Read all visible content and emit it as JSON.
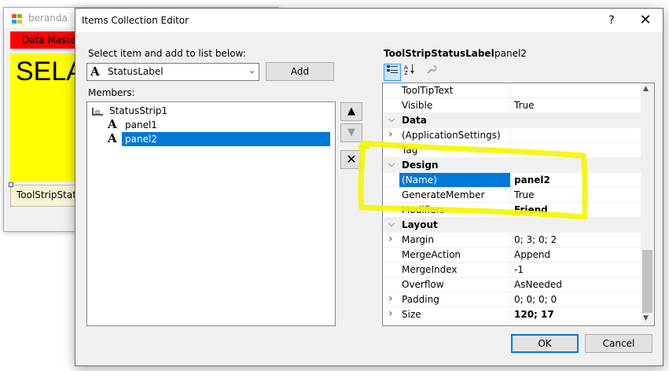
{
  "background_form": {
    "title": "beranda",
    "menu_label": "Data Master",
    "big_text": "SELA",
    "status_label": "ToolStripStatu"
  },
  "dialog": {
    "title": "Items Collection Editor",
    "help_label": "?",
    "close_label": "✕"
  },
  "left": {
    "select_label": "Select item and add to list below:",
    "combo_value": "StatusLabel",
    "add_label": "Add",
    "members_label": "Members:",
    "members": {
      "root": "StatusStrip1",
      "items": [
        "panel1",
        "panel2"
      ],
      "selected": "panel2"
    },
    "side_buttons": {
      "up": "🡅",
      "down": "🡇",
      "remove": "✕"
    }
  },
  "property_grid": {
    "type_name": "ToolStripStatusLabel",
    "object_name": "panel2",
    "rows": [
      {
        "kind": "prop",
        "name": "ToolTipText",
        "value": ""
      },
      {
        "kind": "prop",
        "name": "Visible",
        "value": "True"
      },
      {
        "kind": "cat",
        "name": "Data"
      },
      {
        "kind": "prop",
        "name": "(ApplicationSettings)",
        "value": "",
        "expandable": true
      },
      {
        "kind": "prop",
        "name": "Tag",
        "value": ""
      },
      {
        "kind": "cat",
        "name": "Design"
      },
      {
        "kind": "prop",
        "name": "(Name)",
        "value": "panel2",
        "bold": true,
        "selected": true
      },
      {
        "kind": "prop",
        "name": "GenerateMember",
        "value": "True"
      },
      {
        "kind": "prop",
        "name": "Modifiers",
        "value": "Friend",
        "bold": true
      },
      {
        "kind": "cat",
        "name": "Layout"
      },
      {
        "kind": "prop",
        "name": "Margin",
        "value": "0; 3; 0; 2",
        "expandable": true
      },
      {
        "kind": "prop",
        "name": "MergeAction",
        "value": "Append"
      },
      {
        "kind": "prop",
        "name": "MergeIndex",
        "value": "-1"
      },
      {
        "kind": "prop",
        "name": "Overflow",
        "value": "AsNeeded"
      },
      {
        "kind": "prop",
        "name": "Padding",
        "value": "0; 0; 0; 0",
        "expandable": true
      },
      {
        "kind": "prop",
        "name": "Size",
        "value": "120; 17",
        "bold": true,
        "expandable": true
      }
    ]
  },
  "footer": {
    "ok_label": "OK",
    "cancel_label": "Cancel"
  },
  "colors": {
    "selection": "#0078d7",
    "highlight_annotation": "#f5f500",
    "form_yellow": "#ffff00",
    "form_red": "#ff0000"
  }
}
